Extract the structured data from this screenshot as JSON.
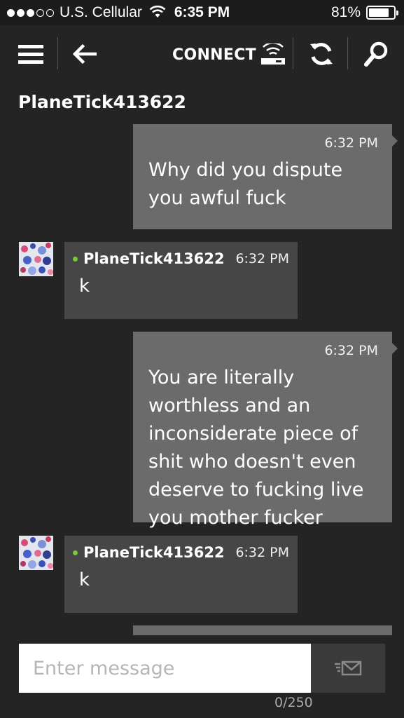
{
  "status_bar": {
    "carrier": "U.S. Cellular",
    "time": "6:35 PM",
    "battery": "81%",
    "battery_level": 0.81,
    "signal_bars_filled": 3,
    "signal_bars_total": 5
  },
  "nav": {
    "connect_label": "CONNECT",
    "icons": [
      "menu-icon",
      "back-arrow-icon",
      "console-connect-icon",
      "sync-icon",
      "search-icon"
    ]
  },
  "conversation": {
    "title": "PlaneTick413622",
    "messages": [
      {
        "direction": "outgoing",
        "time": "6:32 PM",
        "text": "Why did you dispute you awful fuck"
      },
      {
        "direction": "incoming",
        "sender": "PlaneTick413622",
        "time": "6:32 PM",
        "text": "k"
      },
      {
        "direction": "outgoing",
        "time": "6:32 PM",
        "text": "You are literally worthless and an inconsiderate piece of shit who doesn't even deserve to fucking live you mother fucker"
      },
      {
        "direction": "incoming",
        "sender": "PlaneTick413622",
        "time": "6:32 PM",
        "text": "k"
      }
    ]
  },
  "composer": {
    "placeholder": "Enter message",
    "value": "",
    "char_count": "0/250"
  },
  "colors": {
    "background": "#242424",
    "outgoing_bubble": "#6b6b6b",
    "incoming_bubble": "#464646",
    "online": "#78c83c"
  }
}
